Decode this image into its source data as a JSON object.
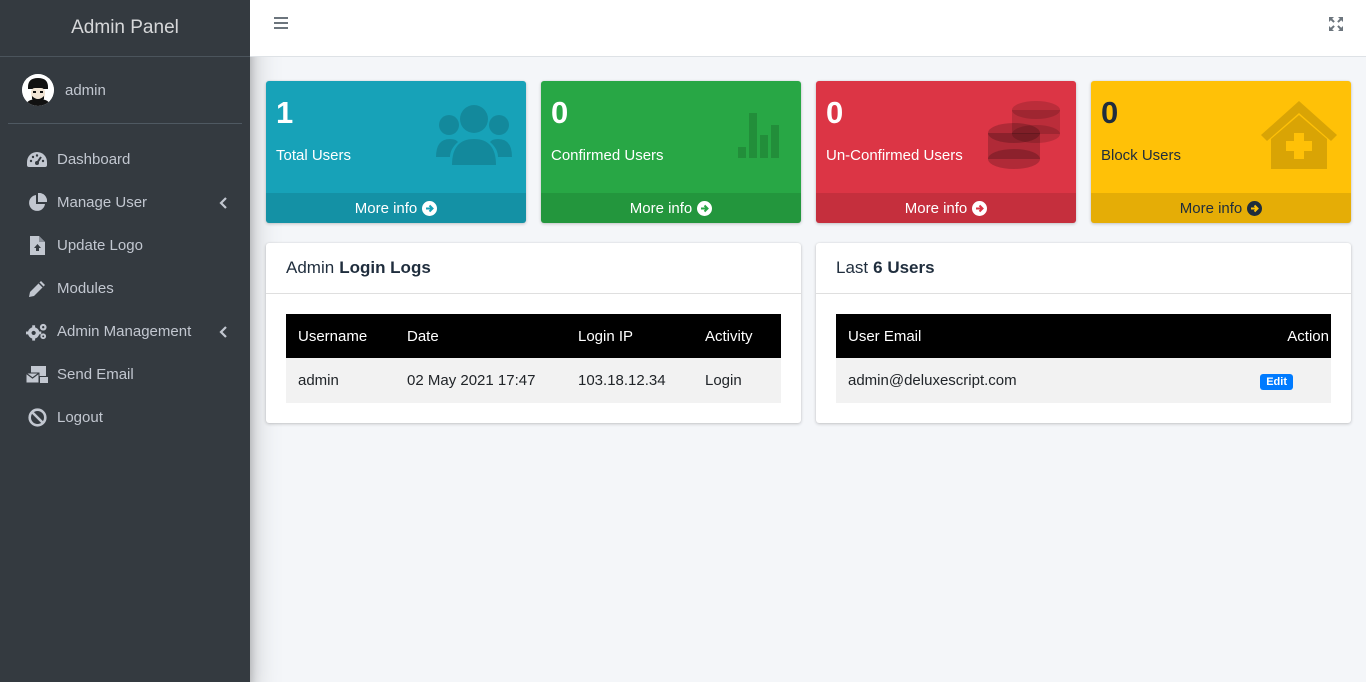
{
  "brand": {
    "title": "Admin Panel"
  },
  "user": {
    "name": "admin"
  },
  "sidebar": {
    "items": [
      {
        "label": "Dashboard",
        "icon": "tachometer-icon"
      },
      {
        "label": "Manage User",
        "icon": "pie-chart-icon",
        "has_submenu": true
      },
      {
        "label": "Update Logo",
        "icon": "file-upload-icon"
      },
      {
        "label": "Modules",
        "icon": "pencil-icon"
      },
      {
        "label": "Admin Management",
        "icon": "cogs-icon",
        "has_submenu": true
      },
      {
        "label": "Send Email",
        "icon": "mail-bulk-icon"
      },
      {
        "label": "Logout",
        "icon": "ban-icon"
      }
    ]
  },
  "stats": [
    {
      "value": "1",
      "label": "Total Users",
      "more": "More info",
      "color": "#17a2b8",
      "icon": "users-icon"
    },
    {
      "value": "0",
      "label": "Confirmed Users",
      "more": "More info",
      "color": "#28a745",
      "icon": "bar-chart-icon"
    },
    {
      "value": "0",
      "label": "Un-Confirmed Users",
      "more": "More info",
      "color": "#dc3545",
      "icon": "coins-icon"
    },
    {
      "value": "0",
      "label": "Block Users",
      "more": "More info",
      "color": "#ffc107",
      "icon": "clinic-house-icon"
    }
  ],
  "login_logs": {
    "title_prefix": "Admin",
    "title_bold": "Login Logs",
    "columns": [
      "Username",
      "Date",
      "Login IP",
      "Activity"
    ],
    "rows": [
      [
        "admin",
        "02 May 2021 17:47",
        "103.18.12.34",
        "Login"
      ]
    ]
  },
  "last_users": {
    "title_prefix": "Last",
    "title_bold": "6 Users",
    "columns": [
      "User Email",
      "Action"
    ],
    "rows": [
      {
        "email": "admin@deluxescript.com",
        "action": "Edit"
      }
    ]
  }
}
